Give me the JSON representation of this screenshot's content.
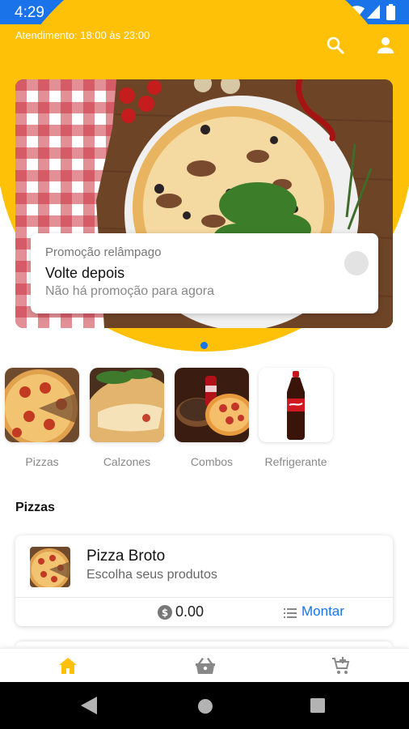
{
  "status_bar": {
    "time": "4:29"
  },
  "header": {
    "opening_hours": "Atendimento: 18:00 às 23:00"
  },
  "promo": {
    "subtitle": "Promoção relâmpago",
    "title": "Volte depois",
    "description": "Não há promoção para agora"
  },
  "categories": [
    {
      "label": "Pizzas"
    },
    {
      "label": "Calzones"
    },
    {
      "label": "Combos"
    },
    {
      "label": "Refrigerante"
    }
  ],
  "section": {
    "title": "Pizzas"
  },
  "products": [
    {
      "name": "Pizza Broto",
      "description": "Escolha seus produtos",
      "price": "0.00",
      "action_label": "Montar"
    }
  ],
  "colors": {
    "accent_yellow": "#ffc107",
    "status_blue": "#1a73e8",
    "link_blue": "#1a73e8"
  },
  "icons": {
    "status": [
      "gear-icon",
      "sd-card-icon",
      "wifi-icon",
      "signal-icon",
      "battery-icon"
    ],
    "header": [
      "search-icon",
      "person-icon"
    ],
    "bottom_nav": [
      "home-icon",
      "basket-icon",
      "cart-add-icon"
    ],
    "system_nav": [
      "back-icon",
      "home-circle-icon",
      "recents-icon"
    ]
  }
}
